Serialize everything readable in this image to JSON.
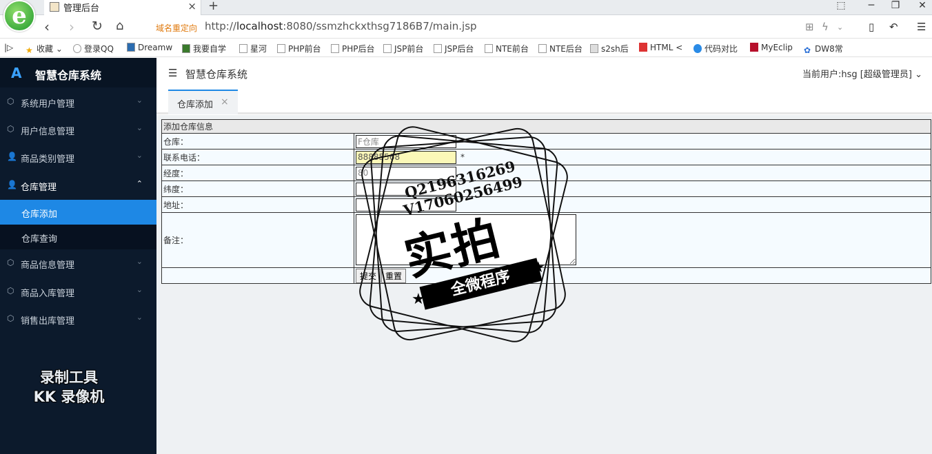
{
  "browser": {
    "tab_title": "管理后台",
    "tab_close": "×",
    "new_tab": "+",
    "redirect_label": "域名重定向",
    "url_prefix": "http://",
    "url_host": "localhost",
    "url_rest": ":8080/ssmzhckxthsg7186B7/main.jsp",
    "bookmarks": [
      "收藏",
      "登录QQ",
      "Dreamw",
      "我要自学",
      "星河",
      "PHP前台",
      "PHP后台",
      "JSP前台",
      "JSP后台",
      "NTE前台",
      "NTE后台",
      "s2sh后",
      "HTML <",
      "代码对比",
      "MyEclip",
      "DW8常"
    ]
  },
  "app": {
    "title": "智慧仓库系统",
    "topbar_title": "智慧仓库系统",
    "current_user": "当前用户:hsg [超级管理员]",
    "open_tab": "仓库添加",
    "open_tab_close": "×",
    "menu": [
      {
        "label": "系统用户管理",
        "icon": "cube-icon"
      },
      {
        "label": "用户信息管理",
        "icon": "cube-icon"
      },
      {
        "label": "商品类别管理",
        "icon": "user-icon"
      },
      {
        "label": "仓库管理",
        "icon": "user-icon",
        "open": true,
        "children": [
          {
            "label": "仓库添加",
            "active": true
          },
          {
            "label": "仓库查询"
          }
        ]
      },
      {
        "label": "商品信息管理",
        "icon": "cube-icon"
      },
      {
        "label": "商品入库管理",
        "icon": "cube-icon"
      },
      {
        "label": "销售出库管理",
        "icon": "cube-icon"
      }
    ],
    "recorder_watermark": [
      "录制工具",
      "KK 录像机"
    ]
  },
  "form": {
    "caption": "添加仓库信息",
    "fields": [
      {
        "label": "仓库：",
        "value": "F仓库",
        "required": "*"
      },
      {
        "label": "联系电话：",
        "value": "88885568",
        "required": "*"
      },
      {
        "label": "经度：",
        "value": "80"
      },
      {
        "label": "纬度：",
        "value": ""
      },
      {
        "label": "地址：",
        "value": ""
      },
      {
        "label": "备注：",
        "value": ""
      }
    ],
    "submit_label": "提交",
    "reset_label": "重置"
  },
  "stamp": {
    "line1": "Q2196316269",
    "line2": "V17060256499",
    "big": "实拍",
    "banner": "全微程序"
  }
}
